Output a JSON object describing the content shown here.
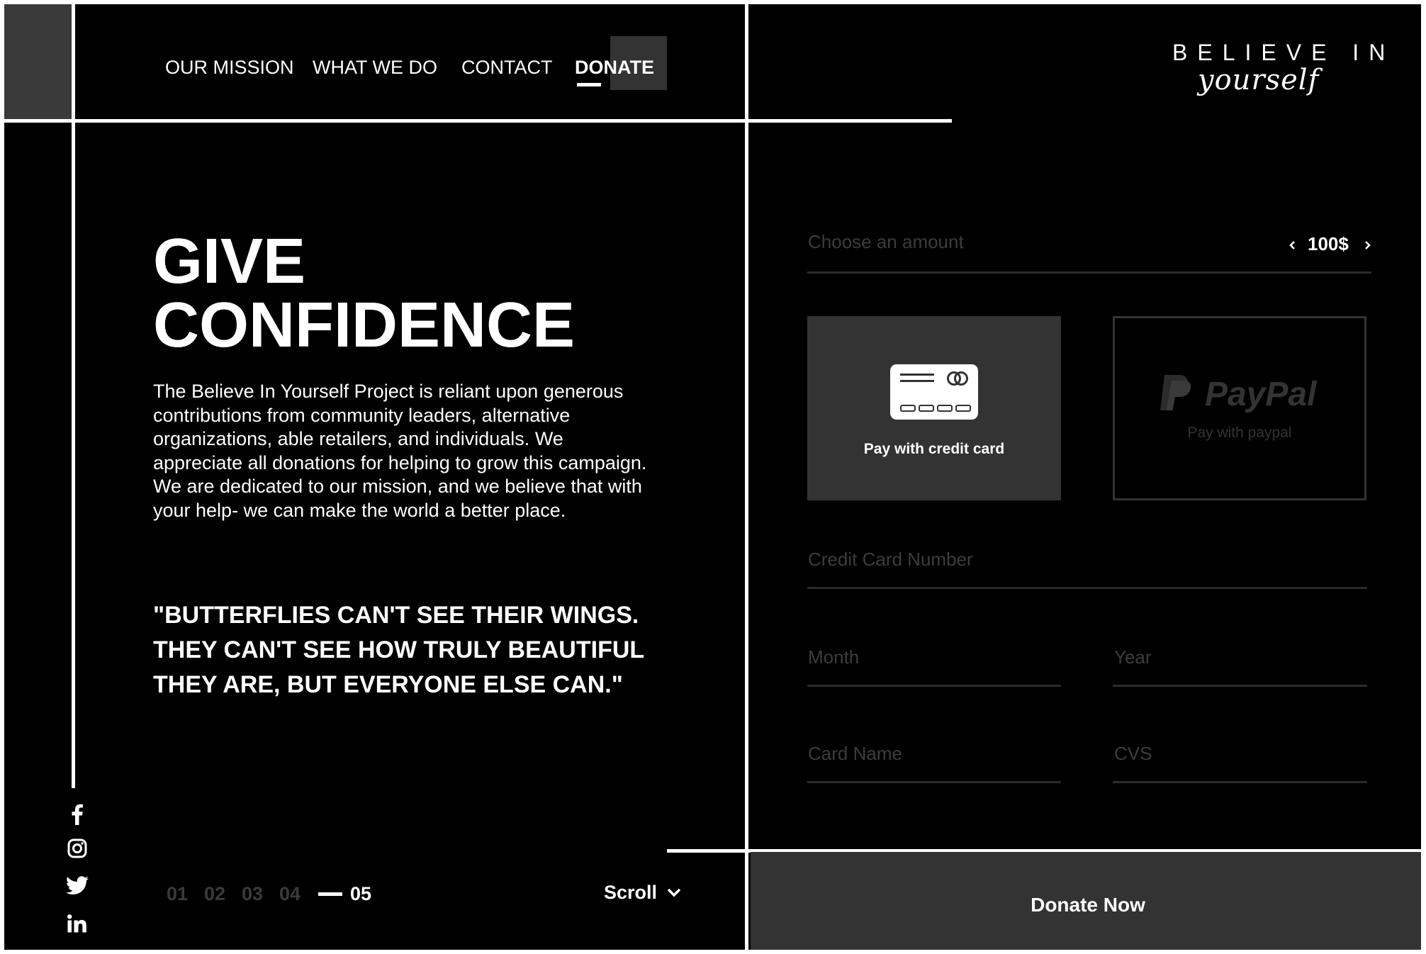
{
  "nav": {
    "items": [
      {
        "label": "OUR MISSION"
      },
      {
        "label": "WHAT WE DO"
      },
      {
        "label": "CONTACT"
      },
      {
        "label": "DONATE"
      }
    ],
    "active": "DONATE"
  },
  "logo": {
    "top_text": "BELIEVE IN",
    "script_text": "yourself"
  },
  "hero": {
    "title_line1": "GIVE",
    "title_line2": "CONFIDENCE",
    "description": "The Believe In Yourself Project is reliant upon generous contributions from community leaders, alternative organizations, able retailers, and individuals. We appreciate all donations for helping to grow this campaign. We are dedicated to our mission, and we believe that with your help- we can make the world a better place.",
    "quote": "\"BUTTERFLIES CAN'T SEE THEIR WINGS. THEY CAN'T SEE HOW TRULY BEAUTIFUL THEY ARE, BUT EVERYONE ELSE CAN.\""
  },
  "social": {
    "icons": [
      "facebook-icon",
      "instagram-icon",
      "twitter-icon",
      "linkedin-icon"
    ]
  },
  "pager": {
    "pages": [
      "01",
      "02",
      "03",
      "04",
      "05"
    ],
    "current": "05",
    "scroll_label": "Scroll"
  },
  "donation_form": {
    "amount_placeholder": "Choose an amount",
    "amount_value": "100$",
    "credit_card_option": "Pay with credit card",
    "paypal_logo": "PayPal",
    "paypal_option": "Pay with paypal",
    "card_number_placeholder": "Credit Card Number",
    "month_placeholder": "Month",
    "year_placeholder": "Year",
    "card_name_placeholder": "Card Name",
    "cvs_placeholder": "CVS",
    "submit_label": "Donate Now"
  },
  "colors": {
    "background": "#000000",
    "panel": "#333333",
    "muted_text": "#3c3c3c",
    "text": "#ffffff"
  }
}
